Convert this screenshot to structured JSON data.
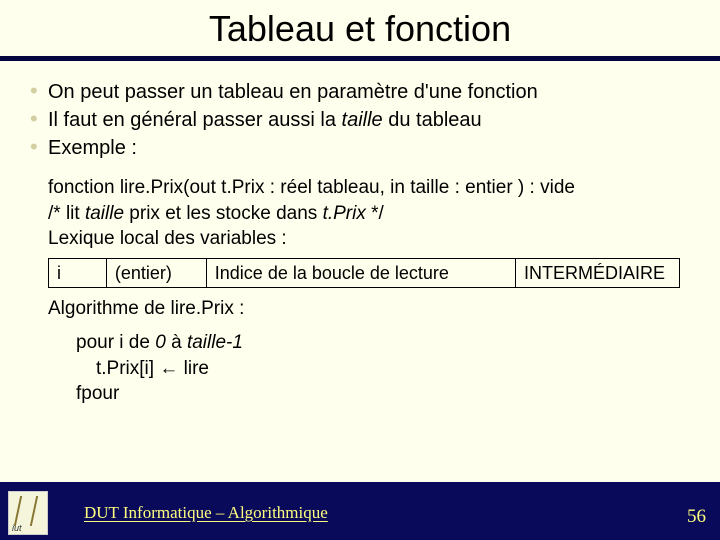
{
  "title": "Tableau et fonction",
  "bullets": [
    {
      "text": "On peut passer un tableau en paramètre d'une fonction"
    },
    {
      "text_html": "Il faut en général passer aussi la <span class=\"italic\">taille</span> du tableau"
    },
    {
      "text": "Exemple :"
    }
  ],
  "func": {
    "signature": "fonction lire.Prix(out t.Prix : réel tableau, in taille : entier ) : vide",
    "comment_html": "/* lit <span class=\"italic\">taille</span> prix et les stocke dans <span class=\"italic\">t.Prix</span> */",
    "lexique_label": "Lexique local des variables :",
    "lex_row": {
      "var": "i",
      "type": "(entier)",
      "desc": "Indice de la boucle de lecture",
      "role": "INTERMÉDIAIRE"
    },
    "algo_label": "Algorithme de lire.Prix :",
    "algo_lines": [
      {
        "html": "pour i de <span class=\"italic\">0</span> à <span class=\"italic\">taille-1</span>"
      },
      {
        "html": "t.Prix[i] <span class=\"arrow\">←</span> lire",
        "indent": true
      },
      {
        "html": "fpour"
      }
    ]
  },
  "footer": {
    "text": "DUT Informatique – Algorithmique",
    "page": "56"
  }
}
